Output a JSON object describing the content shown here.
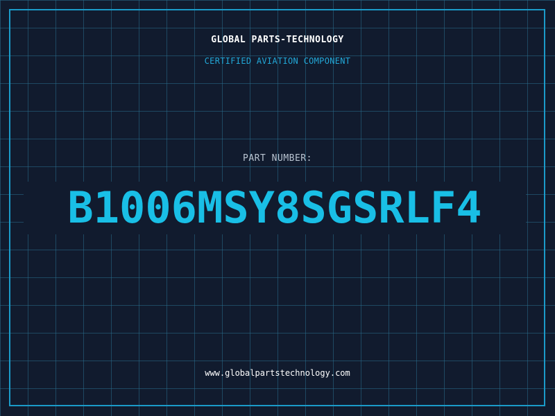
{
  "header": {
    "company_name": "GLOBAL PARTS-TECHNOLOGY",
    "subtitle": "CERTIFIED AVIATION COMPONENT"
  },
  "part": {
    "label": "PART NUMBER:",
    "number": "B1006MSY8SGSRLF4"
  },
  "footer": {
    "website": "www.globalpartstechnology.com"
  },
  "colors": {
    "background": "#111b2e",
    "grid": "#1e5a78",
    "accent": "#19bfe6",
    "frame": "#1b9bc9"
  }
}
